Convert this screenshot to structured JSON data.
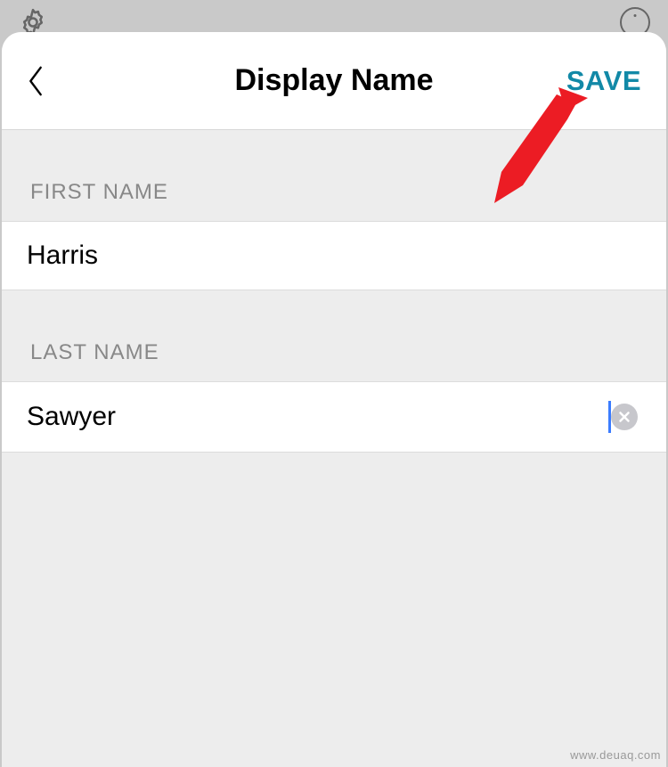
{
  "nav": {
    "title": "Display Name",
    "save_label": "SAVE"
  },
  "sections": {
    "first_name": {
      "header": "FIRST NAME",
      "value": "Harris"
    },
    "last_name": {
      "header": "LAST NAME",
      "value": "Sawyer"
    }
  },
  "watermark": "www.deuaq.com"
}
